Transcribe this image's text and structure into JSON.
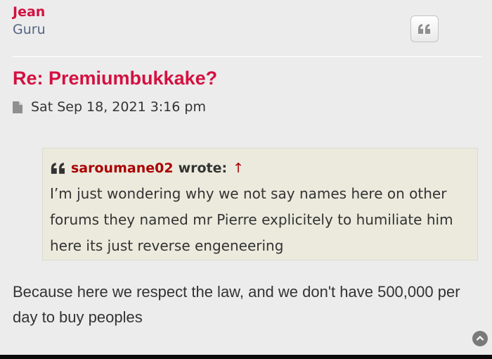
{
  "author": {
    "name": "Jean",
    "rank": "Guru"
  },
  "post": {
    "title": "Re: Premiumbukkake?",
    "date": "Sat Sep 18, 2021 3:16 pm",
    "body": "Because here we respect the law, and we don't have 500,000 per day to buy peoples"
  },
  "quote": {
    "user": "saroumane02",
    "wrote": "wrote:",
    "arrow": "↑",
    "text": "I’m just wondering why we not say names here on other forums they named mr Pierre explicitely to humiliate him here its just reverse engeneering"
  },
  "icons": {
    "quote_button": "quote-icon",
    "file": "file-icon",
    "cite": "quote-icon",
    "back_to_top": "chevron-up-icon"
  },
  "colors": {
    "author": "#d31141",
    "title": "#d31141",
    "quote_user": "#aa0000",
    "background": "#ececec",
    "quote_background": "#ebeadd"
  }
}
